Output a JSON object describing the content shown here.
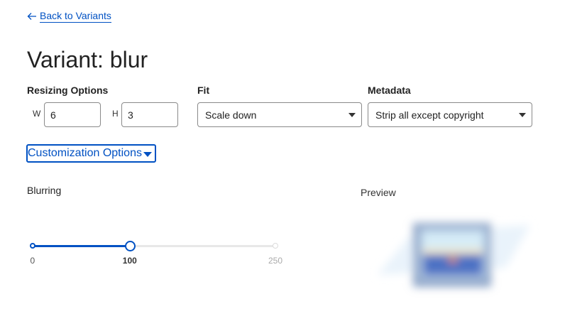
{
  "nav": {
    "back_label": "Back to Variants"
  },
  "page": {
    "title": "Variant: blur"
  },
  "resizing": {
    "label": "Resizing Options",
    "width_letter": "W",
    "width_value": "6",
    "height_letter": "H",
    "height_value": "3"
  },
  "fit": {
    "label": "Fit",
    "selected": "Scale down"
  },
  "metadata": {
    "label": "Metadata",
    "selected": "Strip all except copyright"
  },
  "customization": {
    "label": "Customization Options"
  },
  "blurring": {
    "label": "Blurring",
    "min": 0,
    "max": 250,
    "value": 100,
    "min_label": "0",
    "value_label": "100",
    "max_label": "250"
  },
  "preview": {
    "label": "Preview"
  },
  "colors": {
    "accent": "#0051c3"
  },
  "icons": {
    "back": "arrow-left-icon",
    "select": "chevron-down-icon",
    "toggle": "caret-down-icon"
  }
}
